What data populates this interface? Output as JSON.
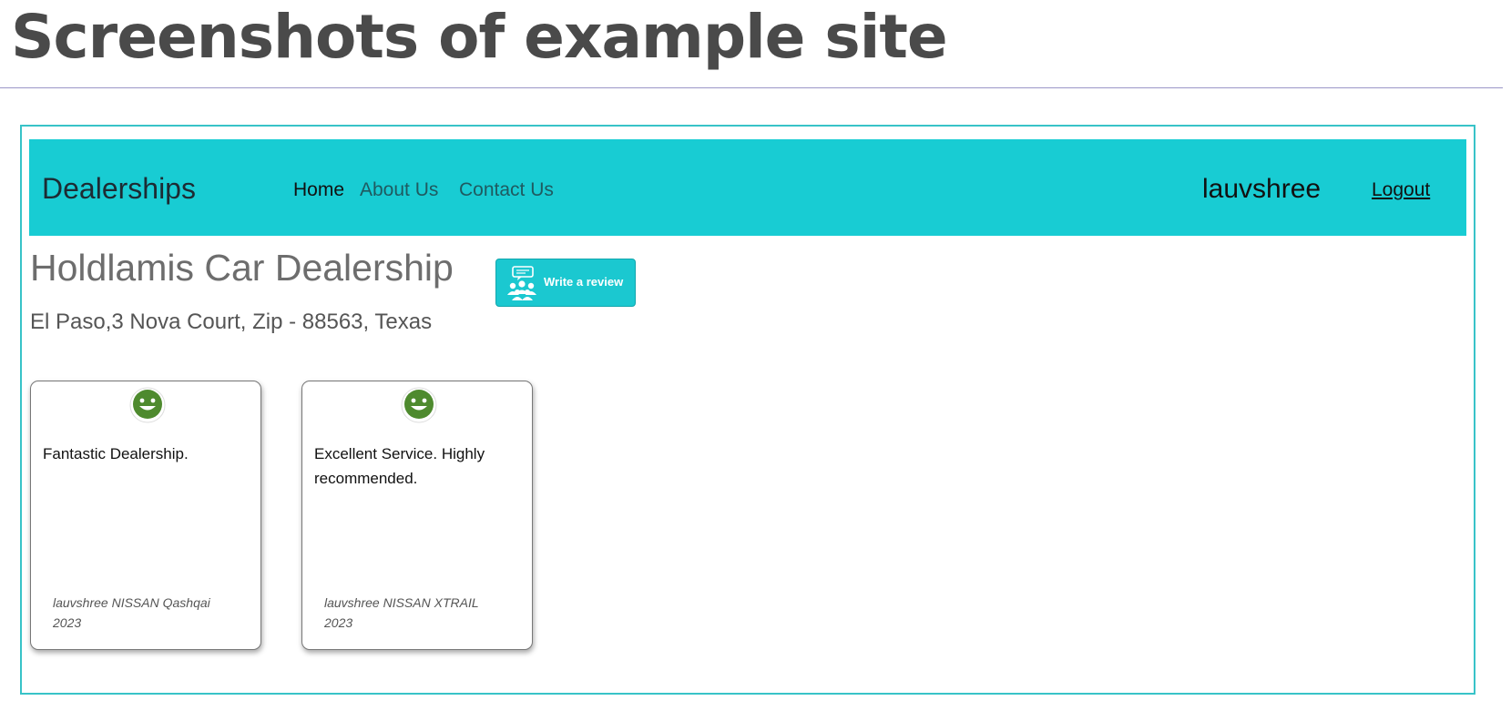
{
  "slide": {
    "title": "Screenshots of example site"
  },
  "navbar": {
    "brand": "Dealerships",
    "links": [
      {
        "label": "Home"
      },
      {
        "label": "About Us"
      },
      {
        "label": "Contact Us"
      }
    ],
    "username": "lauvshree",
    "logout_label": "Logout"
  },
  "dealer": {
    "name": "Holdlamis Car Dealership",
    "address": "El Paso,3 Nova Court, Zip - 88563, Texas",
    "write_review_label": "Write a review",
    "write_review_icon": "people-chat-icon"
  },
  "reviews": [
    {
      "text": "Fantastic Dealership.",
      "reviewer": "lauvshree NISSAN Qashqai 2023",
      "sentiment_icon": "smiley-face-icon"
    },
    {
      "text": "Excellent Service. Highly recommended.",
      "reviewer": "lauvshree NISSAN XTRAIL 2023",
      "sentiment_icon": "smiley-face-icon"
    }
  ],
  "colors": {
    "navbar_bg": "#18ccd3",
    "frame_border": "#38c3c8",
    "smiley_green": "#4e8a2e",
    "title_gray": "#4a4a4a"
  }
}
